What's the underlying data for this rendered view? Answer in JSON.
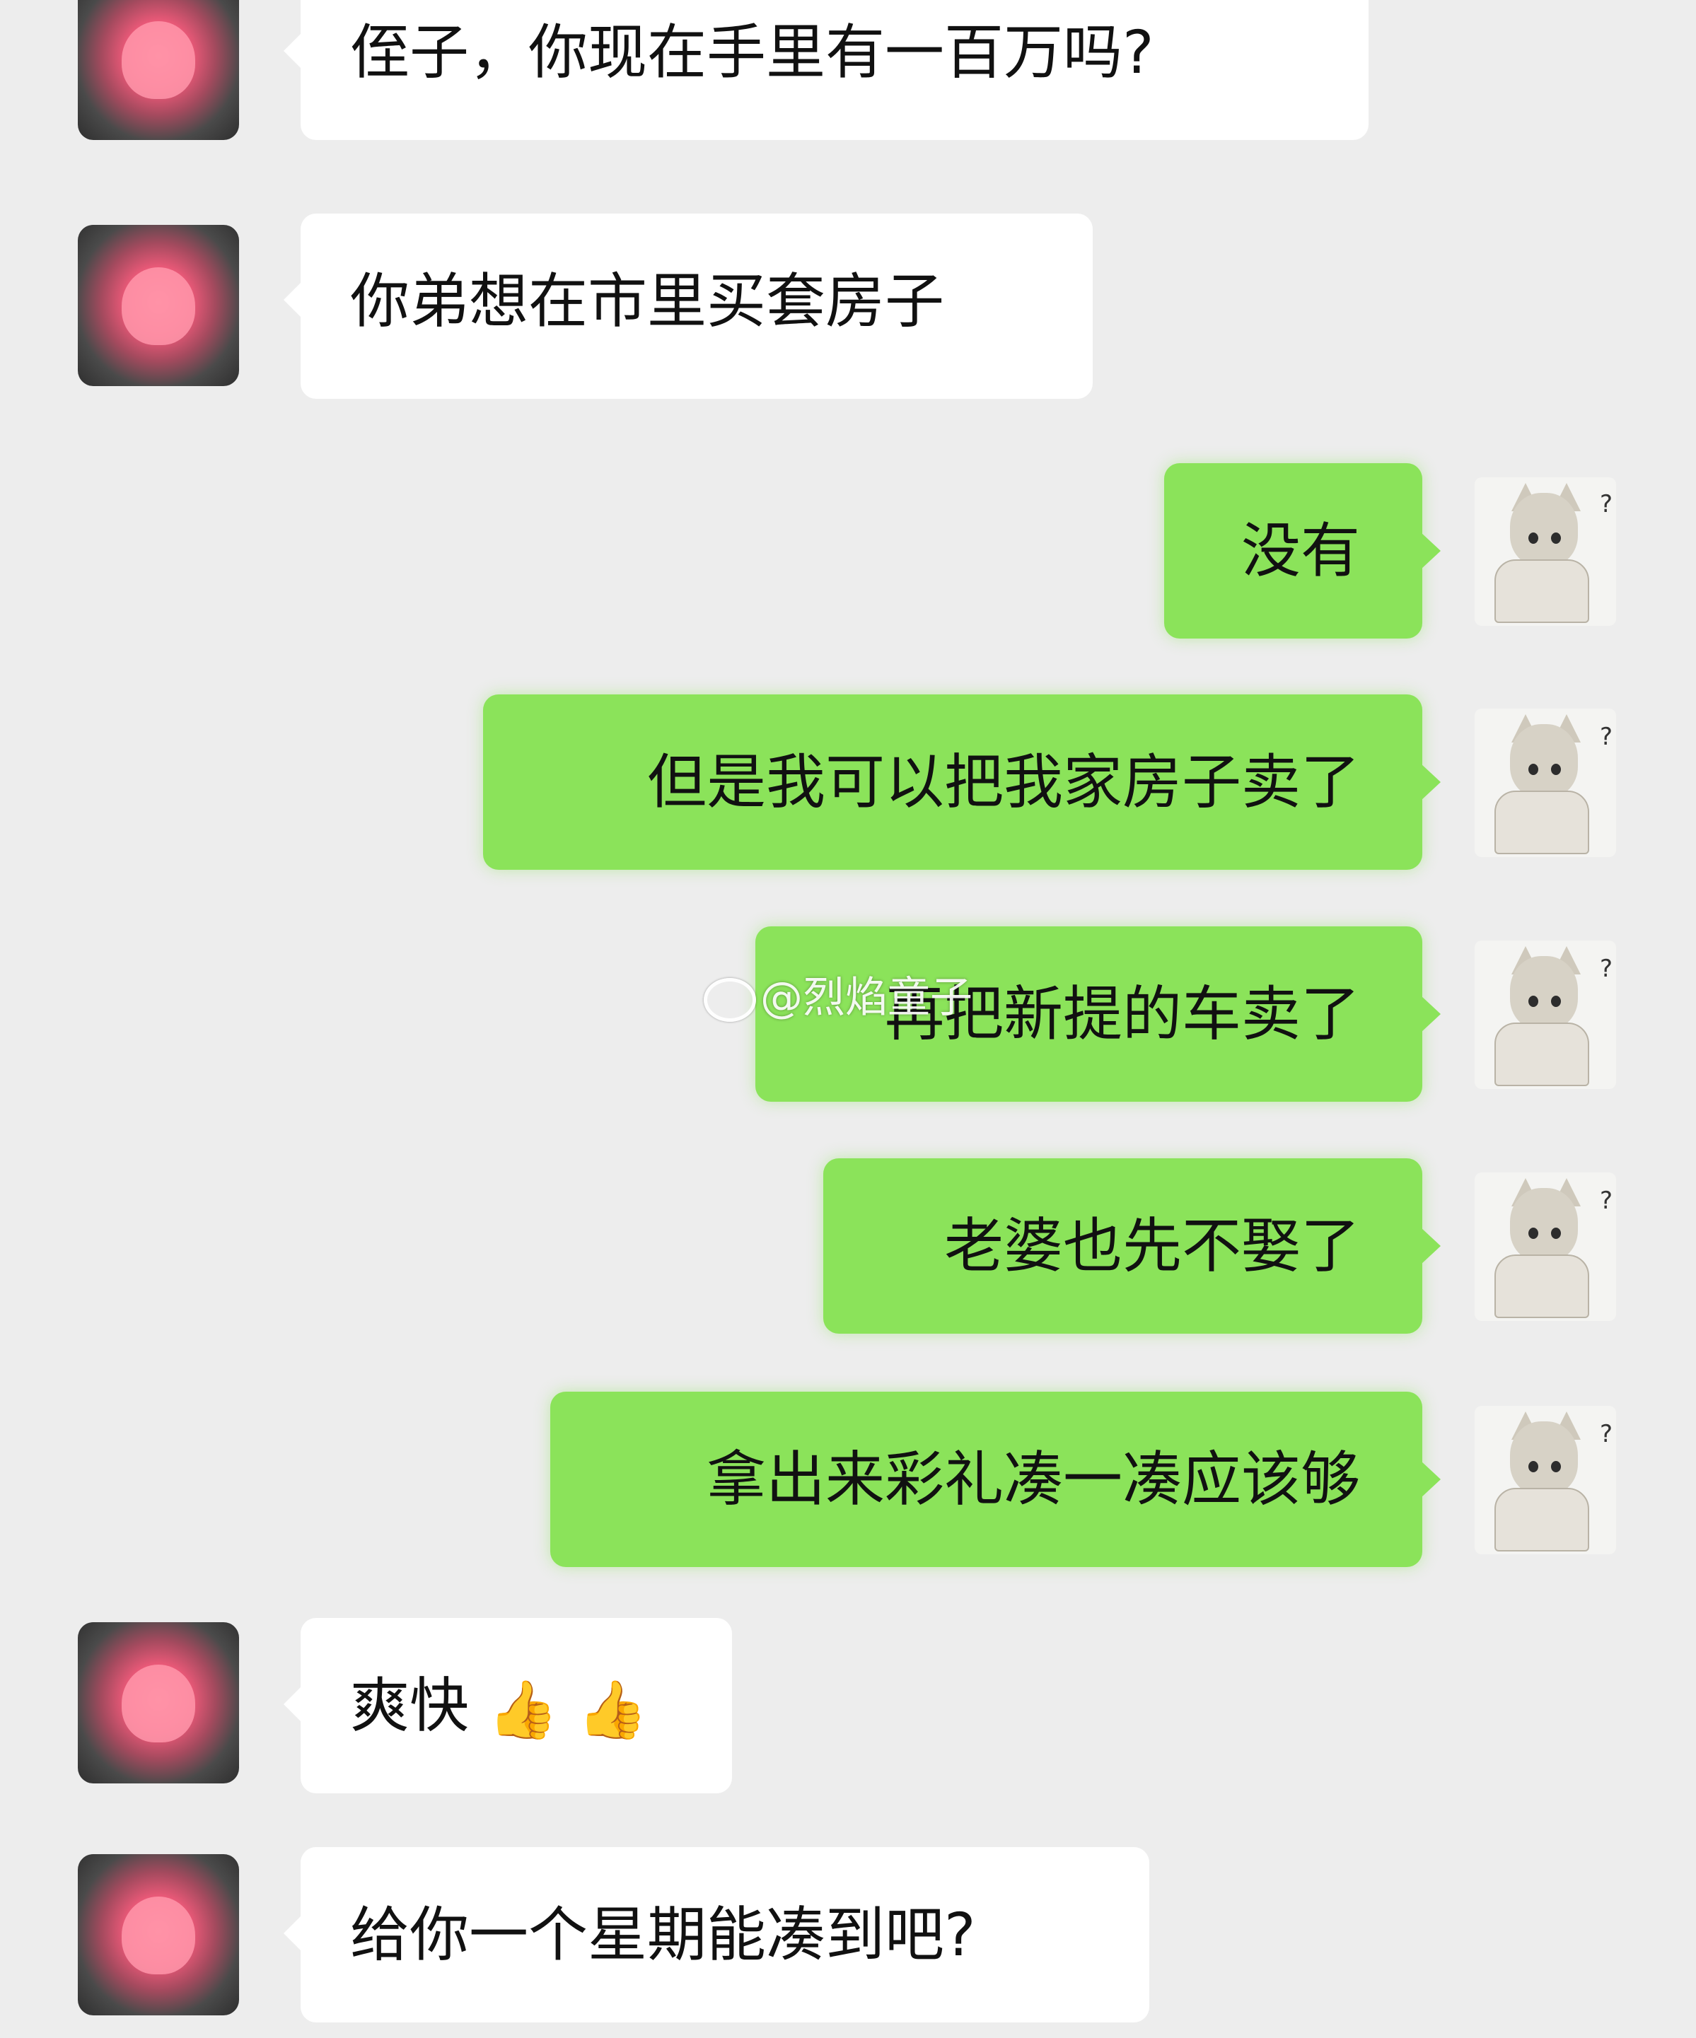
{
  "messages": [
    {
      "side": "left",
      "text": "侄子，你现在手里有一百万吗?"
    },
    {
      "side": "left",
      "text": "你弟想在市里买套房子"
    },
    {
      "side": "right",
      "text": "没有"
    },
    {
      "side": "right",
      "text": "但是我可以把我家房子卖了"
    },
    {
      "side": "right",
      "text": "再把新提的车卖了"
    },
    {
      "side": "right",
      "text": "老婆也先不娶了"
    },
    {
      "side": "right",
      "text": "拿出来彩礼凑一凑应该够"
    },
    {
      "side": "left",
      "text": "爽快",
      "emoji": [
        "thumbs-up-icon",
        "thumbs-up-icon"
      ]
    },
    {
      "side": "left",
      "text": "给你一个星期能凑到吧?"
    }
  ],
  "avatar_right_mark": "?",
  "avatar_left_caption": "",
  "watermark": "@烈焰童子",
  "colors": {
    "background": "#ededed",
    "left_bubble": "#ffffff",
    "right_bubble": "#8be35a"
  }
}
